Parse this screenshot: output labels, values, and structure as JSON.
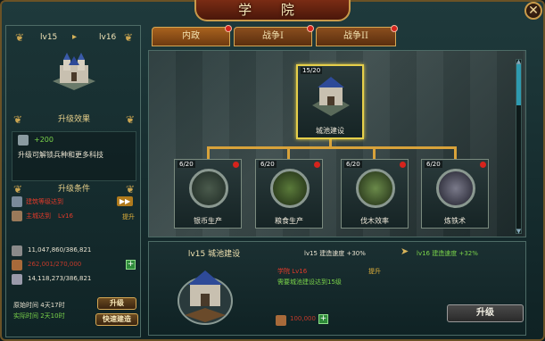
{
  "title": "学 院",
  "tabs": [
    {
      "label": "内政"
    },
    {
      "label": "战争I"
    },
    {
      "label": "战争II"
    }
  ],
  "left": {
    "level_from": "lv15",
    "level_to": "lv16",
    "effect_title": "升级效果",
    "effect_plus": "+200",
    "effect_text": "升级可解锁兵种和更多科技",
    "condition_title": "升级条件",
    "cond1": "建筑等级达到",
    "cond1_tag": "",
    "cond2_a": "主城达到",
    "cond2_b": "Lv16",
    "cond2_tag": "提升",
    "res1": "11,047,860/386,821",
    "res2": "262,001/270,000",
    "res3": "14,118,273/386,821",
    "time_label": "原始时间",
    "time_value": "4天17时",
    "time_actual": "实际时间 2天10时",
    "upgrade_btn": "升级",
    "quick_btn": "快速建造"
  },
  "nodes": [
    {
      "level": "15/20",
      "name": "城池建设"
    },
    {
      "level": "6/20",
      "name": "银币生产"
    },
    {
      "level": "6/20",
      "name": "粮食生产"
    },
    {
      "level": "6/20",
      "name": "伐木效率"
    },
    {
      "level": "6/20",
      "name": "炼铁术"
    }
  ],
  "detail": {
    "head_level": "lv15",
    "head_name": "城池建设",
    "speed_current_label": "lv15 建造速度",
    "speed_current_value": "+30%",
    "speed_next_label": "lv16 建造速度",
    "speed_next_value": "+32%",
    "req_red": "学院 Lv16",
    "req_tag": "提升",
    "req_green": "需要城池建设达到15级",
    "cost": "100,000",
    "upgrade_btn": "升级"
  }
}
